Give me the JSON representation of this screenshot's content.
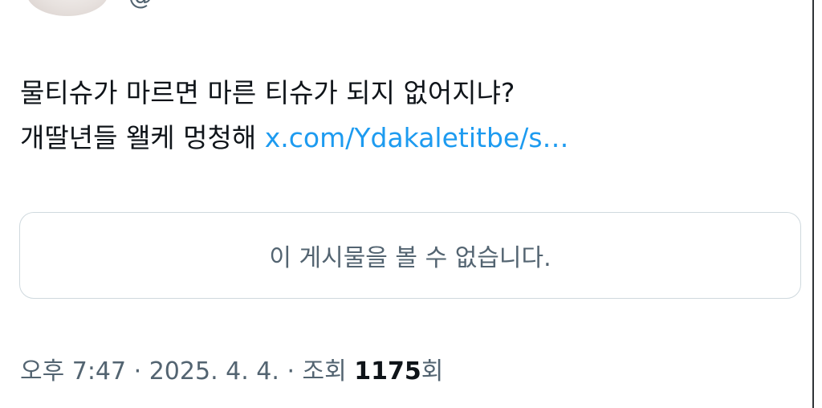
{
  "author": {
    "handle": "@"
  },
  "tweet": {
    "line1": "물티슈가 마르면 마른 티슈가 되지 없어지냐?",
    "line2": "개딸년들 왤케 멍청해",
    "link": "x.com/Ydakaletitbe/s…"
  },
  "quoted": {
    "message": "이 게시물을 볼 수 없습니다."
  },
  "meta": {
    "time": "오후 7:47",
    "separator": " · ",
    "date": "2025. 4. 4.",
    "views_prefix": "조회 ",
    "views_count": "1175",
    "views_suffix": "회"
  },
  "colors": {
    "text": "#0f1419",
    "secondary": "#536471",
    "link": "#1d9bf0",
    "border": "#cfd9de"
  }
}
